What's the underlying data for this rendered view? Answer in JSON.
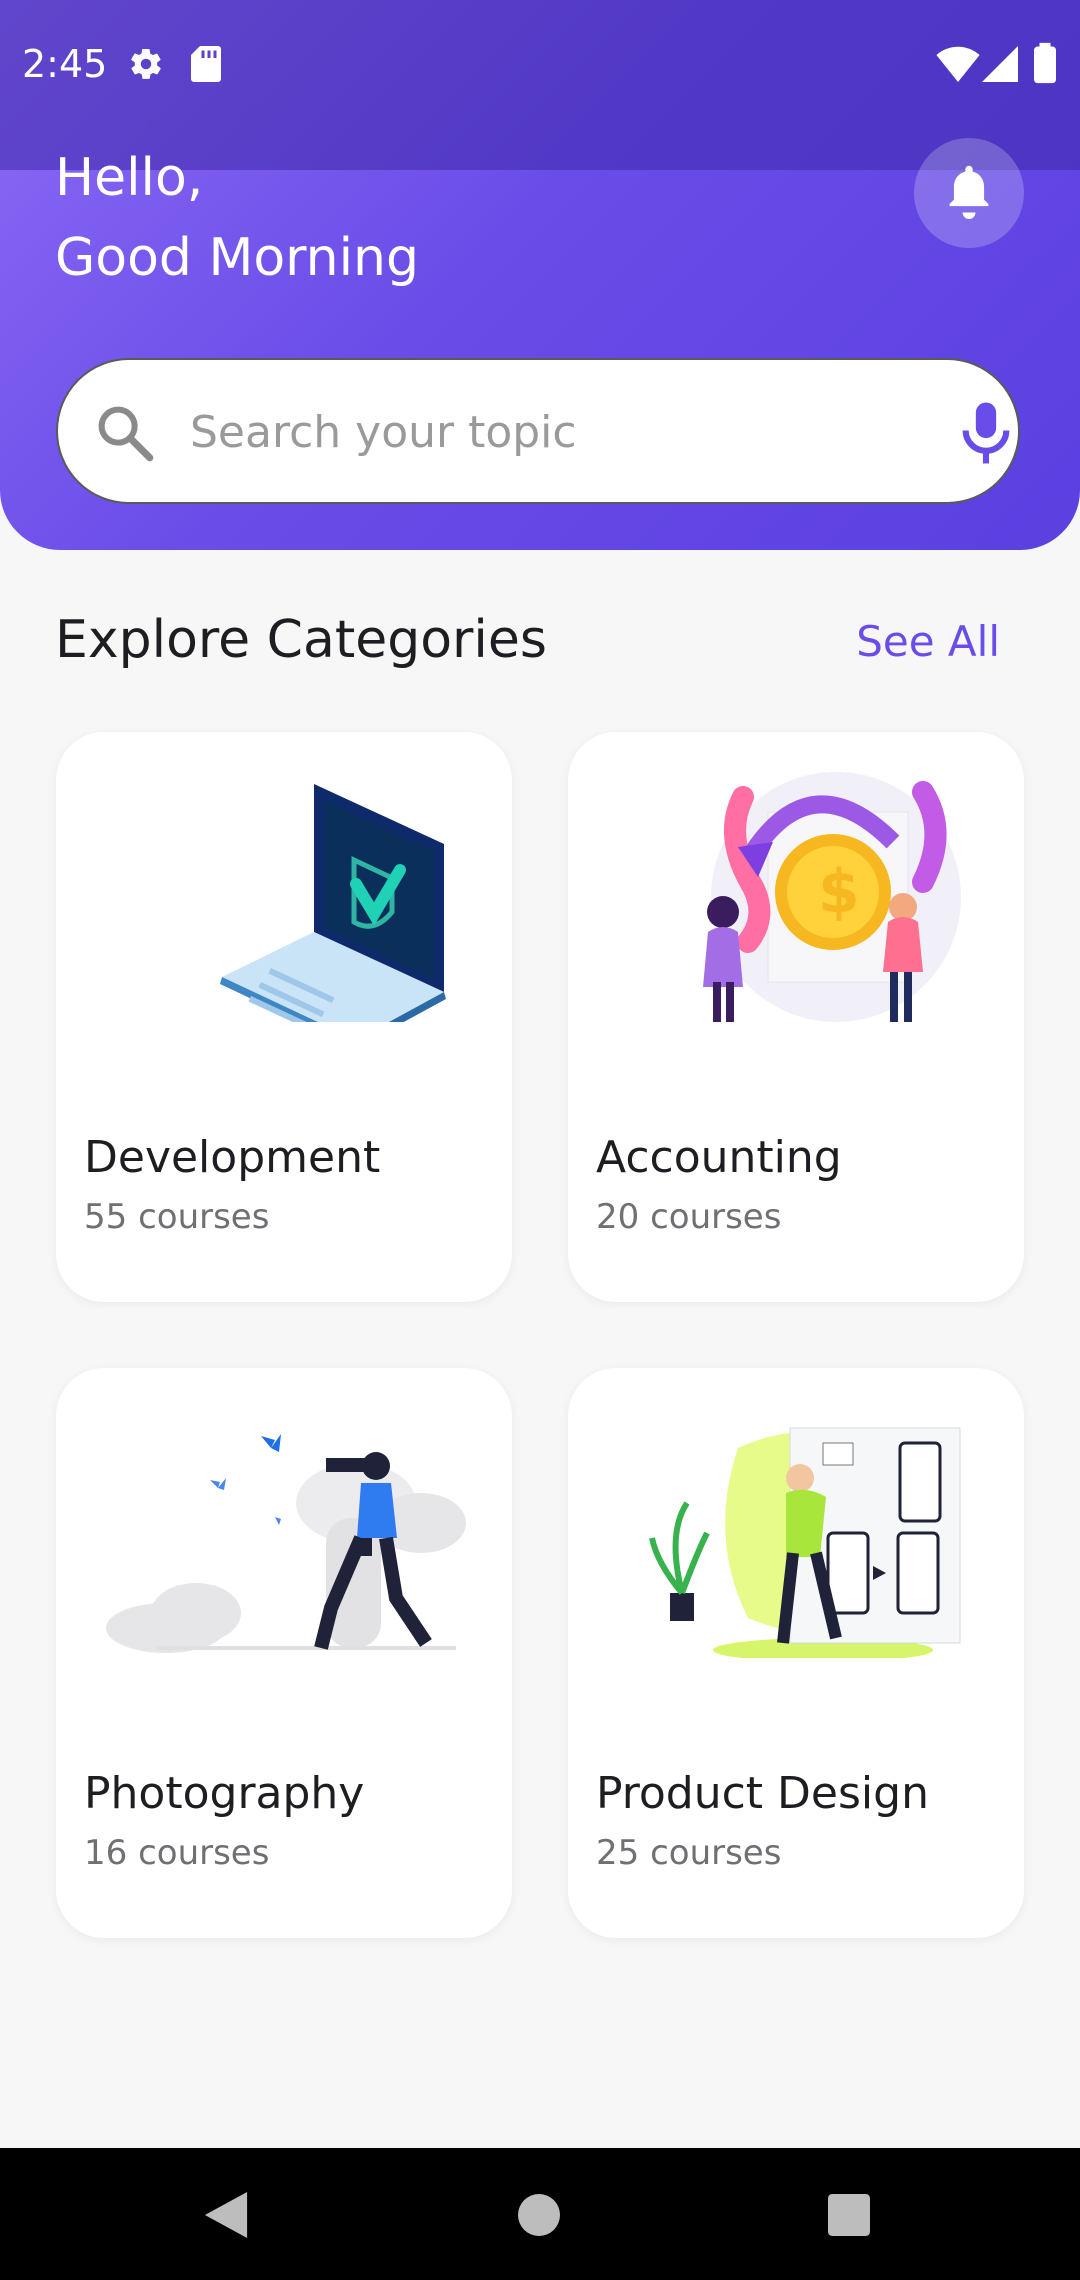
{
  "status": {
    "time": "2:45"
  },
  "header": {
    "greeting_line1": "Hello,",
    "greeting_line2": "Good Morning"
  },
  "search": {
    "placeholder": "Search your topic"
  },
  "section": {
    "title": "Explore Categories",
    "see_all": "See All"
  },
  "categories": [
    {
      "name": "Development",
      "count": "55 courses",
      "icon": "laptop-shield-illustration"
    },
    {
      "name": "Accounting",
      "count": "20 courses",
      "icon": "coin-exchange-illustration"
    },
    {
      "name": "Photography",
      "count": "16 courses",
      "icon": "photographer-illustration"
    },
    {
      "name": "Product Design",
      "count": "25 courses",
      "icon": "ui-design-illustration"
    }
  ],
  "colors": {
    "accent": "#6a4ce8",
    "header_start": "#8c6bf5",
    "header_end": "#5b3fe0"
  }
}
